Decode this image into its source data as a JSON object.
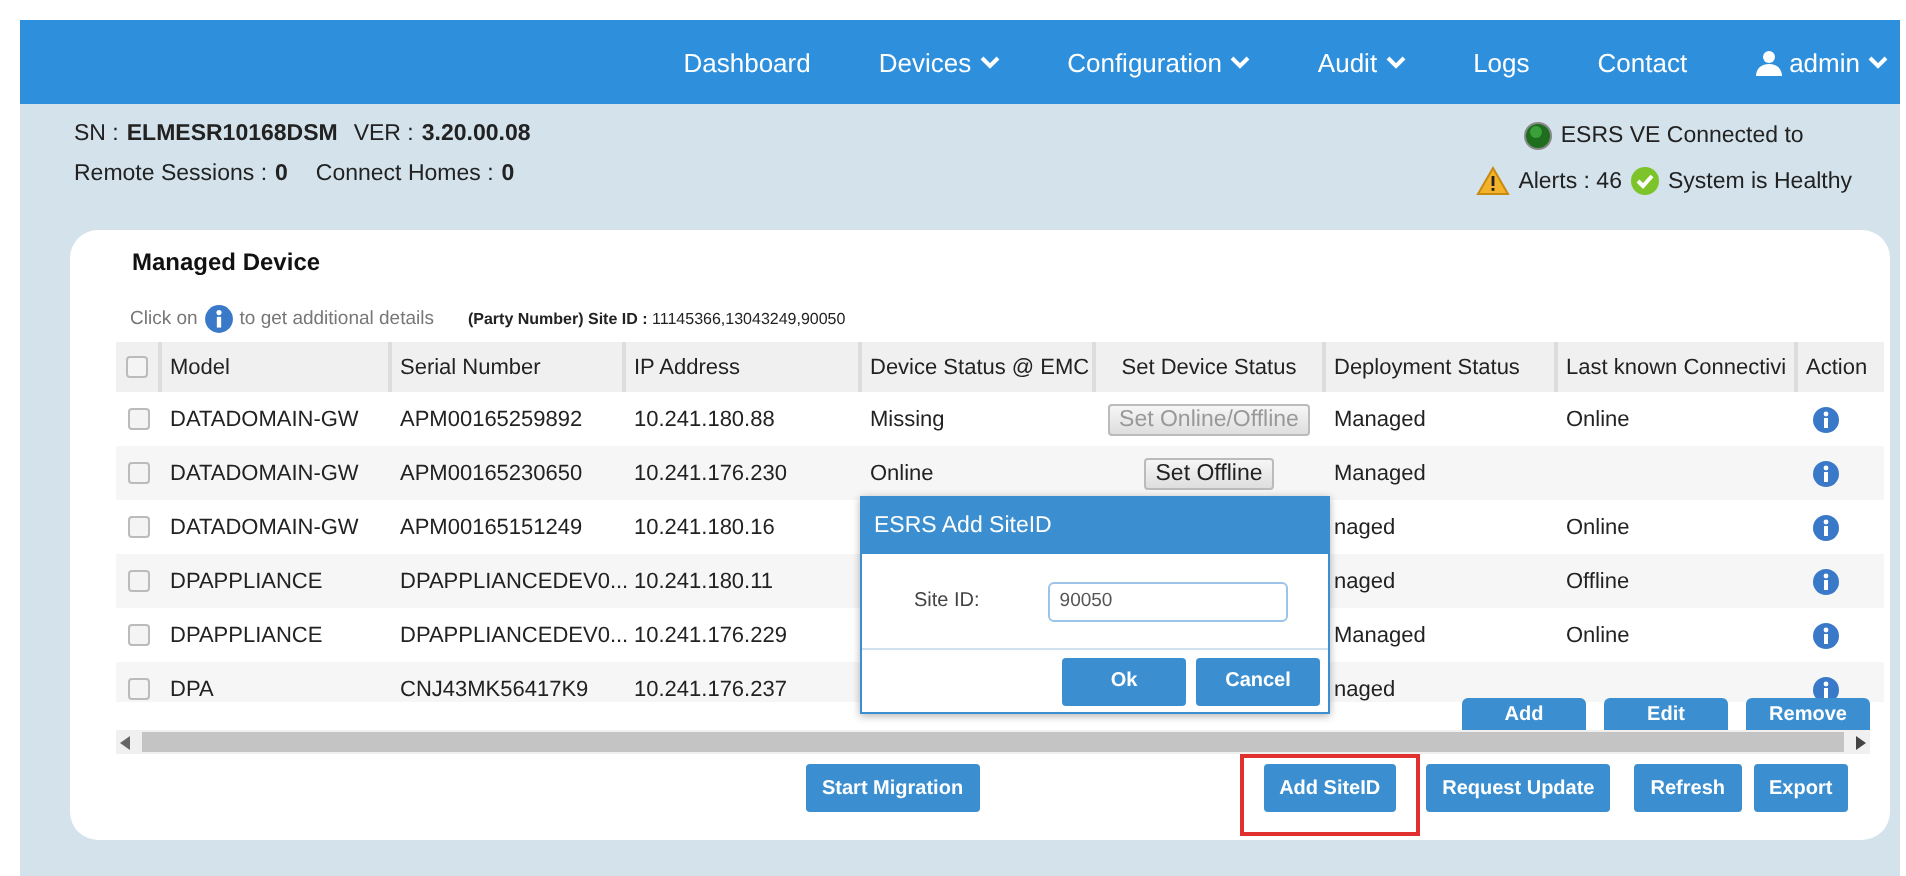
{
  "nav": {
    "items": [
      {
        "label": "Dashboard",
        "dropdown": false
      },
      {
        "label": "Devices",
        "dropdown": true
      },
      {
        "label": "Configuration",
        "dropdown": true
      },
      {
        "label": "Audit",
        "dropdown": true
      },
      {
        "label": "Logs",
        "dropdown": false
      },
      {
        "label": "Contact",
        "dropdown": false
      }
    ],
    "user": {
      "label": "admin",
      "dropdown": true
    }
  },
  "summary": {
    "sn_label": "SN :",
    "sn": "ELMESR10168DSM",
    "ver_label": "VER :",
    "ver": "3.20.00.08",
    "remote_label": "Remote Sessions :",
    "remote": "0",
    "homes_label": "Connect Homes :",
    "homes": "0",
    "connection": "ESRS VE Connected to",
    "alerts": "Alerts : 46",
    "health": "System is Healthy"
  },
  "panel": {
    "title": "Managed Device",
    "hint_before": "Click on",
    "hint_after": "to get additional details",
    "site_label": "(Party Number) Site ID :",
    "site_ids": "11145366,13043249,90050"
  },
  "table": {
    "header_checked": false,
    "columns": [
      "Model",
      "Serial Number",
      "IP Address",
      "Device Status @ EMC",
      "Set Device Status",
      "Deployment Status",
      "Last known Connectivi",
      "Action"
    ],
    "rows": [
      {
        "checked": false,
        "model": "DATADOMAIN-GW",
        "serial": "APM00165259892",
        "ip": "10.241.180.88",
        "device_status": "Missing",
        "set_button": {
          "label": "Set Online/Offline",
          "disabled": true
        },
        "deployment": "Managed",
        "connectivity": "Online",
        "action": true
      },
      {
        "checked": false,
        "model": "DATADOMAIN-GW",
        "serial": "APM00165230650",
        "ip": "10.241.176.230",
        "device_status": "Online",
        "set_button": {
          "label": "Set Offline",
          "disabled": false
        },
        "deployment": "Managed",
        "action": true
      },
      {
        "checked": false,
        "model": "DATADOMAIN-GW",
        "serial": "APM00165151249",
        "ip": "10.241.180.16",
        "deployment": "naged",
        "connectivity": "Online",
        "action": true
      },
      {
        "checked": false,
        "model": "DPAPPLIANCE",
        "serial": "DPAPPLIANCEDEV0...",
        "ip": "10.241.180.11",
        "deployment": "naged",
        "connectivity": "Offline",
        "action": true
      },
      {
        "checked": false,
        "model": "DPAPPLIANCE",
        "serial": "DPAPPLIANCEDEV0...",
        "ip": "10.241.176.229",
        "deployment": "Managed",
        "connectivity": "Online",
        "action": true
      },
      {
        "checked": false,
        "model": "DPA",
        "serial": "CNJ43MK56417K9",
        "ip": "10.241.176.237",
        "deployment": "naged",
        "action": true
      }
    ],
    "actions": [
      "Add",
      "Edit",
      "Remove"
    ]
  },
  "footer_buttons": [
    {
      "label": "Start Migration",
      "highlighted": false
    },
    {
      "label": "Add SiteID",
      "highlighted": true
    },
    {
      "label": "Request Update",
      "highlighted": false
    },
    {
      "label": "Refresh",
      "highlighted": false
    },
    {
      "label": "Export",
      "highlighted": false
    }
  ],
  "dialog": {
    "title": "ESRS Add SiteID",
    "field_label": "Site ID:",
    "value": "90050",
    "buttons": [
      "Ok",
      "Cancel"
    ]
  }
}
